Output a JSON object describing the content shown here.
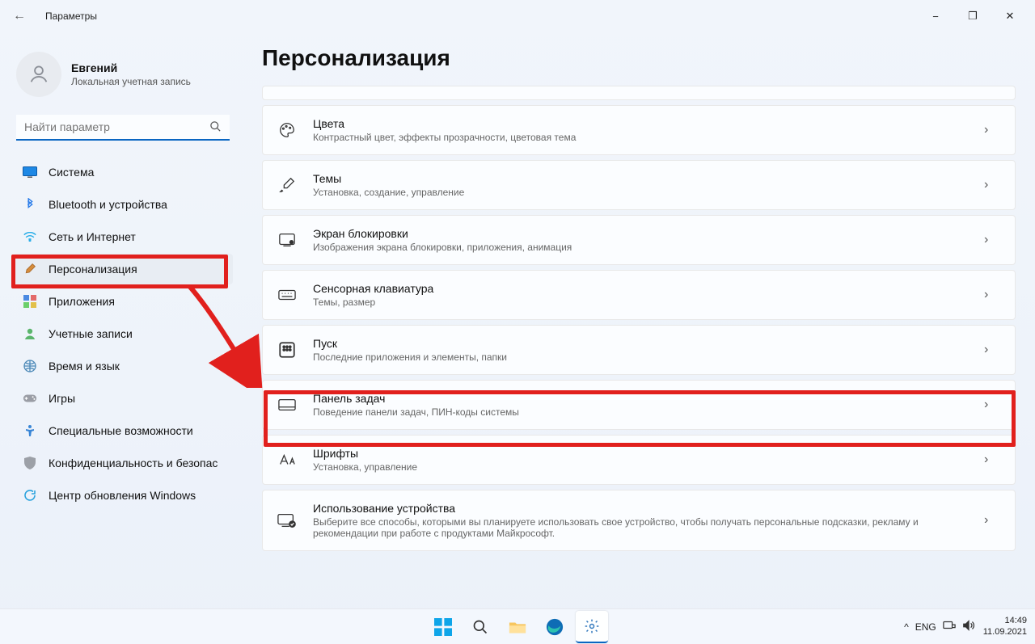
{
  "window": {
    "title": "Параметры"
  },
  "user": {
    "name": "Евгений",
    "sub": "Локальная учетная запись"
  },
  "search": {
    "placeholder": "Найти параметр"
  },
  "nav": [
    {
      "label": "Система"
    },
    {
      "label": "Bluetooth и устройства"
    },
    {
      "label": "Сеть и Интернет"
    },
    {
      "label": "Персонализация"
    },
    {
      "label": "Приложения"
    },
    {
      "label": "Учетные записи"
    },
    {
      "label": "Время и язык"
    },
    {
      "label": "Игры"
    },
    {
      "label": "Специальные возможности"
    },
    {
      "label": "Конфиденциальность и безопас"
    },
    {
      "label": "Центр обновления Windows"
    }
  ],
  "page": {
    "title": "Персонализация"
  },
  "cards": [
    {
      "title": "Цвета",
      "sub": "Контрастный цвет, эффекты прозрачности, цветовая тема"
    },
    {
      "title": "Темы",
      "sub": "Установка, создание, управление"
    },
    {
      "title": "Экран блокировки",
      "sub": "Изображения экрана блокировки, приложения, анимация"
    },
    {
      "title": "Сенсорная клавиатура",
      "sub": "Темы, размер"
    },
    {
      "title": "Пуск",
      "sub": "Последние приложения и элементы, папки"
    },
    {
      "title": "Панель задач",
      "sub": "Поведение панели задач, ПИН-коды системы"
    },
    {
      "title": "Шрифты",
      "sub": "Установка, управление"
    },
    {
      "title": "Использование устройства",
      "sub": "Выберите все способы, которыми вы планируете использовать свое устройство, чтобы получать персональные подсказки, рекламу и рекомендации при работе с продуктами Майкрософт."
    }
  ],
  "tray": {
    "lang": "ENG",
    "time": "14:49",
    "date": "11.09.2021"
  }
}
